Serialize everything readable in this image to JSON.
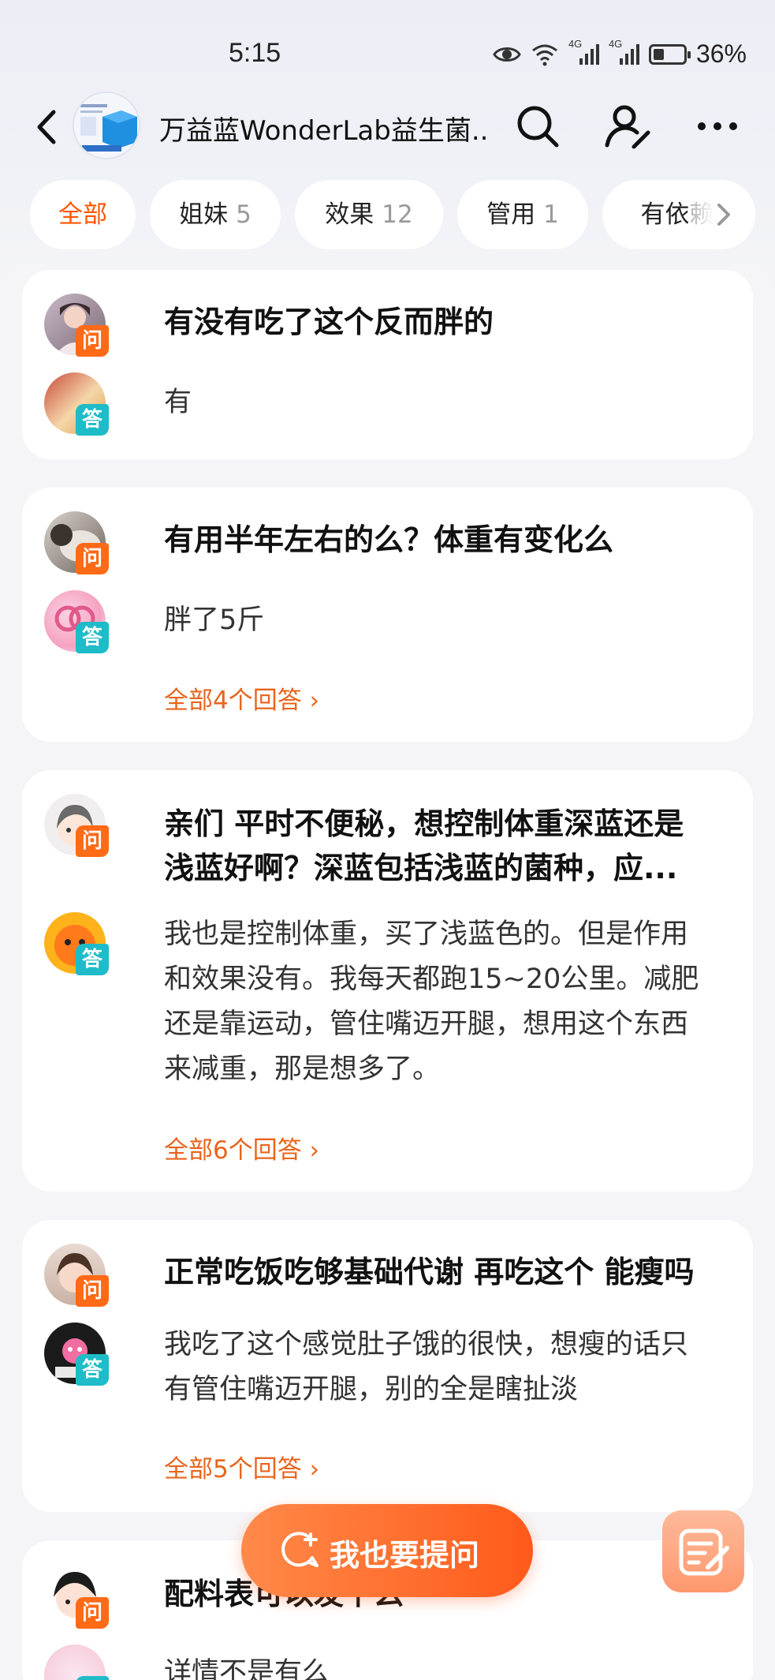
{
  "status_bar": {
    "time": "5:15",
    "battery_text": "36%",
    "battery_level": 0.36,
    "net1": "4G",
    "net2": "4G"
  },
  "header": {
    "title": "万益蓝WonderLab益生菌..."
  },
  "tabs": [
    {
      "label": "全部",
      "count": ""
    },
    {
      "label": "姐妹",
      "count": "5"
    },
    {
      "label": "效果",
      "count": "12"
    },
    {
      "label": "管用",
      "count": "1"
    },
    {
      "label": "有依赖",
      "count": ""
    }
  ],
  "badges": {
    "question": "问",
    "answer": "答"
  },
  "qa": [
    {
      "question": "有没有吃了这个反而胖的",
      "answer": "有",
      "all_answers": ""
    },
    {
      "question": "有用半年左右的么？体重有变化么",
      "answer": "胖了5斤",
      "all_answers": "全部4个回答 ›"
    },
    {
      "question_lines": [
        "亲们 平时不便秘，想控制体重深蓝还是",
        "浅蓝好啊？深蓝包括浅蓝的菌种，应..."
      ],
      "answer_lines": [
        "我也是控制体重，买了浅蓝色的。但是作用",
        "和效果没有。我每天都跑15~20公里。减肥",
        "还是靠运动，管住嘴迈开腿，想用这个东西",
        "来减重，那是想多了。"
      ],
      "all_answers": "全部6个回答 ›"
    },
    {
      "question": "正常吃饭吃够基础代谢 再吃这个 能瘦吗",
      "answer_lines": [
        "我吃了这个感觉肚子饿的很快，想瘦的话只",
        "有管住嘴迈开腿，别的全是瞎扯淡"
      ],
      "all_answers": "全部5个回答 ›"
    },
    {
      "question": "配料表可以发下么",
      "answer": "详情不是有么",
      "all_answers": ""
    }
  ],
  "floating": {
    "ask_label": "我也要提问"
  }
}
